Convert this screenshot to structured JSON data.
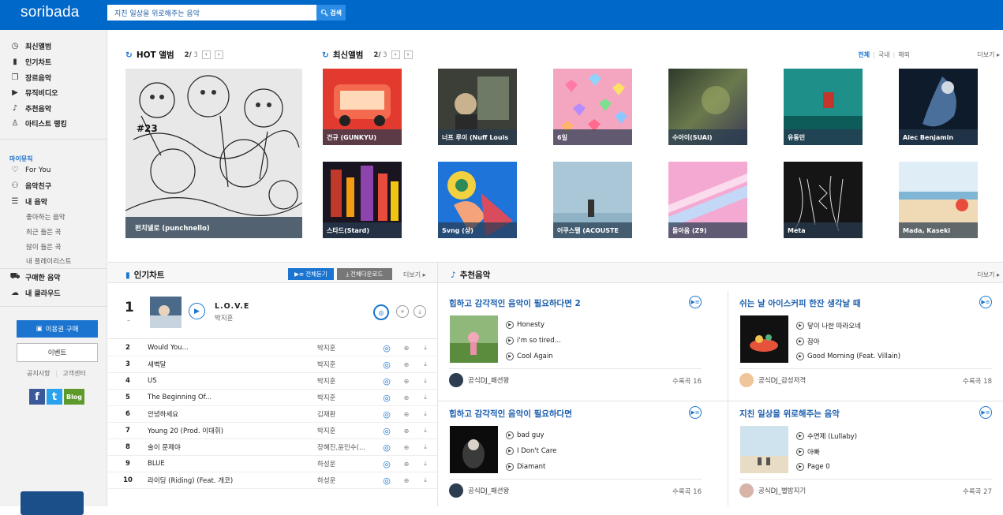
{
  "header": {
    "logo": "soribada",
    "search_value": "지친 일상을 위로해주는 음악",
    "search_button": "검색"
  },
  "sidebar": {
    "nav": [
      {
        "label": "최신앨범",
        "icon": "clock-icon"
      },
      {
        "label": "인기차트",
        "icon": "chart-bars-icon"
      },
      {
        "label": "장르음악",
        "icon": "stack-icon"
      },
      {
        "label": "뮤직비디오",
        "icon": "video-icon"
      },
      {
        "label": "추천음악",
        "icon": "note-icon"
      },
      {
        "label": "아티스트 랭킹",
        "icon": "person-icon"
      }
    ],
    "my_music_label": "마이뮤직",
    "my_nav": [
      {
        "label": "For You",
        "icon": "heart-icon"
      },
      {
        "label": "음악친구",
        "icon": "friends-icon"
      },
      {
        "label": "내 음악",
        "icon": "playlist-icon"
      }
    ],
    "my_sub": [
      "좋아하는 음악",
      "최근 들은 곡",
      "많이 들은 곡",
      "내 플레이리스트"
    ],
    "purchase": "구매한 음악",
    "cloud": "내 클라우드",
    "buy_button": "이용권 구매",
    "event_button": "이벤트",
    "notice": "공지사항",
    "support": "고객센터",
    "social": {
      "facebook": "f",
      "twitter": "t",
      "blog": "Blog"
    }
  },
  "hot": {
    "title": "HOT 앨범",
    "page": "2/",
    "total": " 3",
    "feature_caption": "펀치넬로 (punchnello)"
  },
  "latest": {
    "title": "최신앨범",
    "page": "2/",
    "total": " 3",
    "tabs": [
      "전체",
      "국내",
      "해외"
    ],
    "more": "더보기 ▸",
    "albums": [
      "건규 (GUNKYU)",
      "너프 루이 (Nuff Louis",
      "6일",
      "수아이(SUAI)",
      "유동민",
      "Alec Benjamin",
      "스타드(Stard)",
      "Svng (상)",
      "어쿠스텔 (ACOUSTE",
      "돌아옴 (Z9)",
      "Meta",
      "Mada, Kaseki"
    ]
  },
  "chart": {
    "title": "인기차트",
    "play_all": "전체듣기",
    "download_all": "전체다운로드",
    "more": "더보기 ▸",
    "first": {
      "rank": "1",
      "change": "–",
      "title": "L.O.V.E",
      "artist": "박지훈"
    },
    "rows": [
      {
        "rank": "2",
        "title": "Would You...",
        "artist": "박지훈"
      },
      {
        "rank": "3",
        "title": "새벽달",
        "artist": "박지훈"
      },
      {
        "rank": "4",
        "title": "US",
        "artist": "박지훈"
      },
      {
        "rank": "5",
        "title": "The Beginning Of...",
        "artist": "박지훈"
      },
      {
        "rank": "6",
        "title": "안녕하세요",
        "artist": "김재환"
      },
      {
        "rank": "7",
        "title": "Young 20 (Prod. 이대휘)",
        "artist": "박지훈"
      },
      {
        "rank": "8",
        "title": "술이 문제야",
        "artist": "장혜진,윤민수(..."
      },
      {
        "rank": "9",
        "title": "BLUE",
        "artist": "하성운"
      },
      {
        "rank": "10",
        "title": "라이딩 (Riding) (Feat. 개코)",
        "artist": "하성운"
      }
    ]
  },
  "recommend": {
    "title": "추천음악",
    "more": "더보기 ▸",
    "cards": [
      {
        "title": "힙하고 감각적인 음악이 필요하다면 2",
        "tracks": [
          "Honesty",
          "i'm so tired...",
          "Cool Again"
        ],
        "dj": "공식DJ_패션왕",
        "count": "수록곡 16"
      },
      {
        "title": "쉬는 날 아이스커피 한잔 생각날 때",
        "tracks": [
          "닿이 나한 따라오네",
          "잠아",
          "Good Morning (Feat. Villain)"
        ],
        "dj": "공식DJ_감성저격",
        "count": "수록곡 18"
      },
      {
        "title": "힙하고 감각적인 음악이 필요하다면",
        "tracks": [
          "bad guy",
          "I Don't Care",
          "Diamant"
        ],
        "dj": "공식DJ_패션왕",
        "count": "수록곡 16"
      },
      {
        "title": "지친 일상을 위로해주는 음악",
        "tracks": [
          "수면제 (Lullaby)",
          "아빠",
          "Page 0"
        ],
        "dj": "공식DJ_별밤지기",
        "count": "수록곡 27"
      }
    ]
  },
  "colors": {
    "brand": "#0068c9",
    "accent": "#1b75d0"
  }
}
